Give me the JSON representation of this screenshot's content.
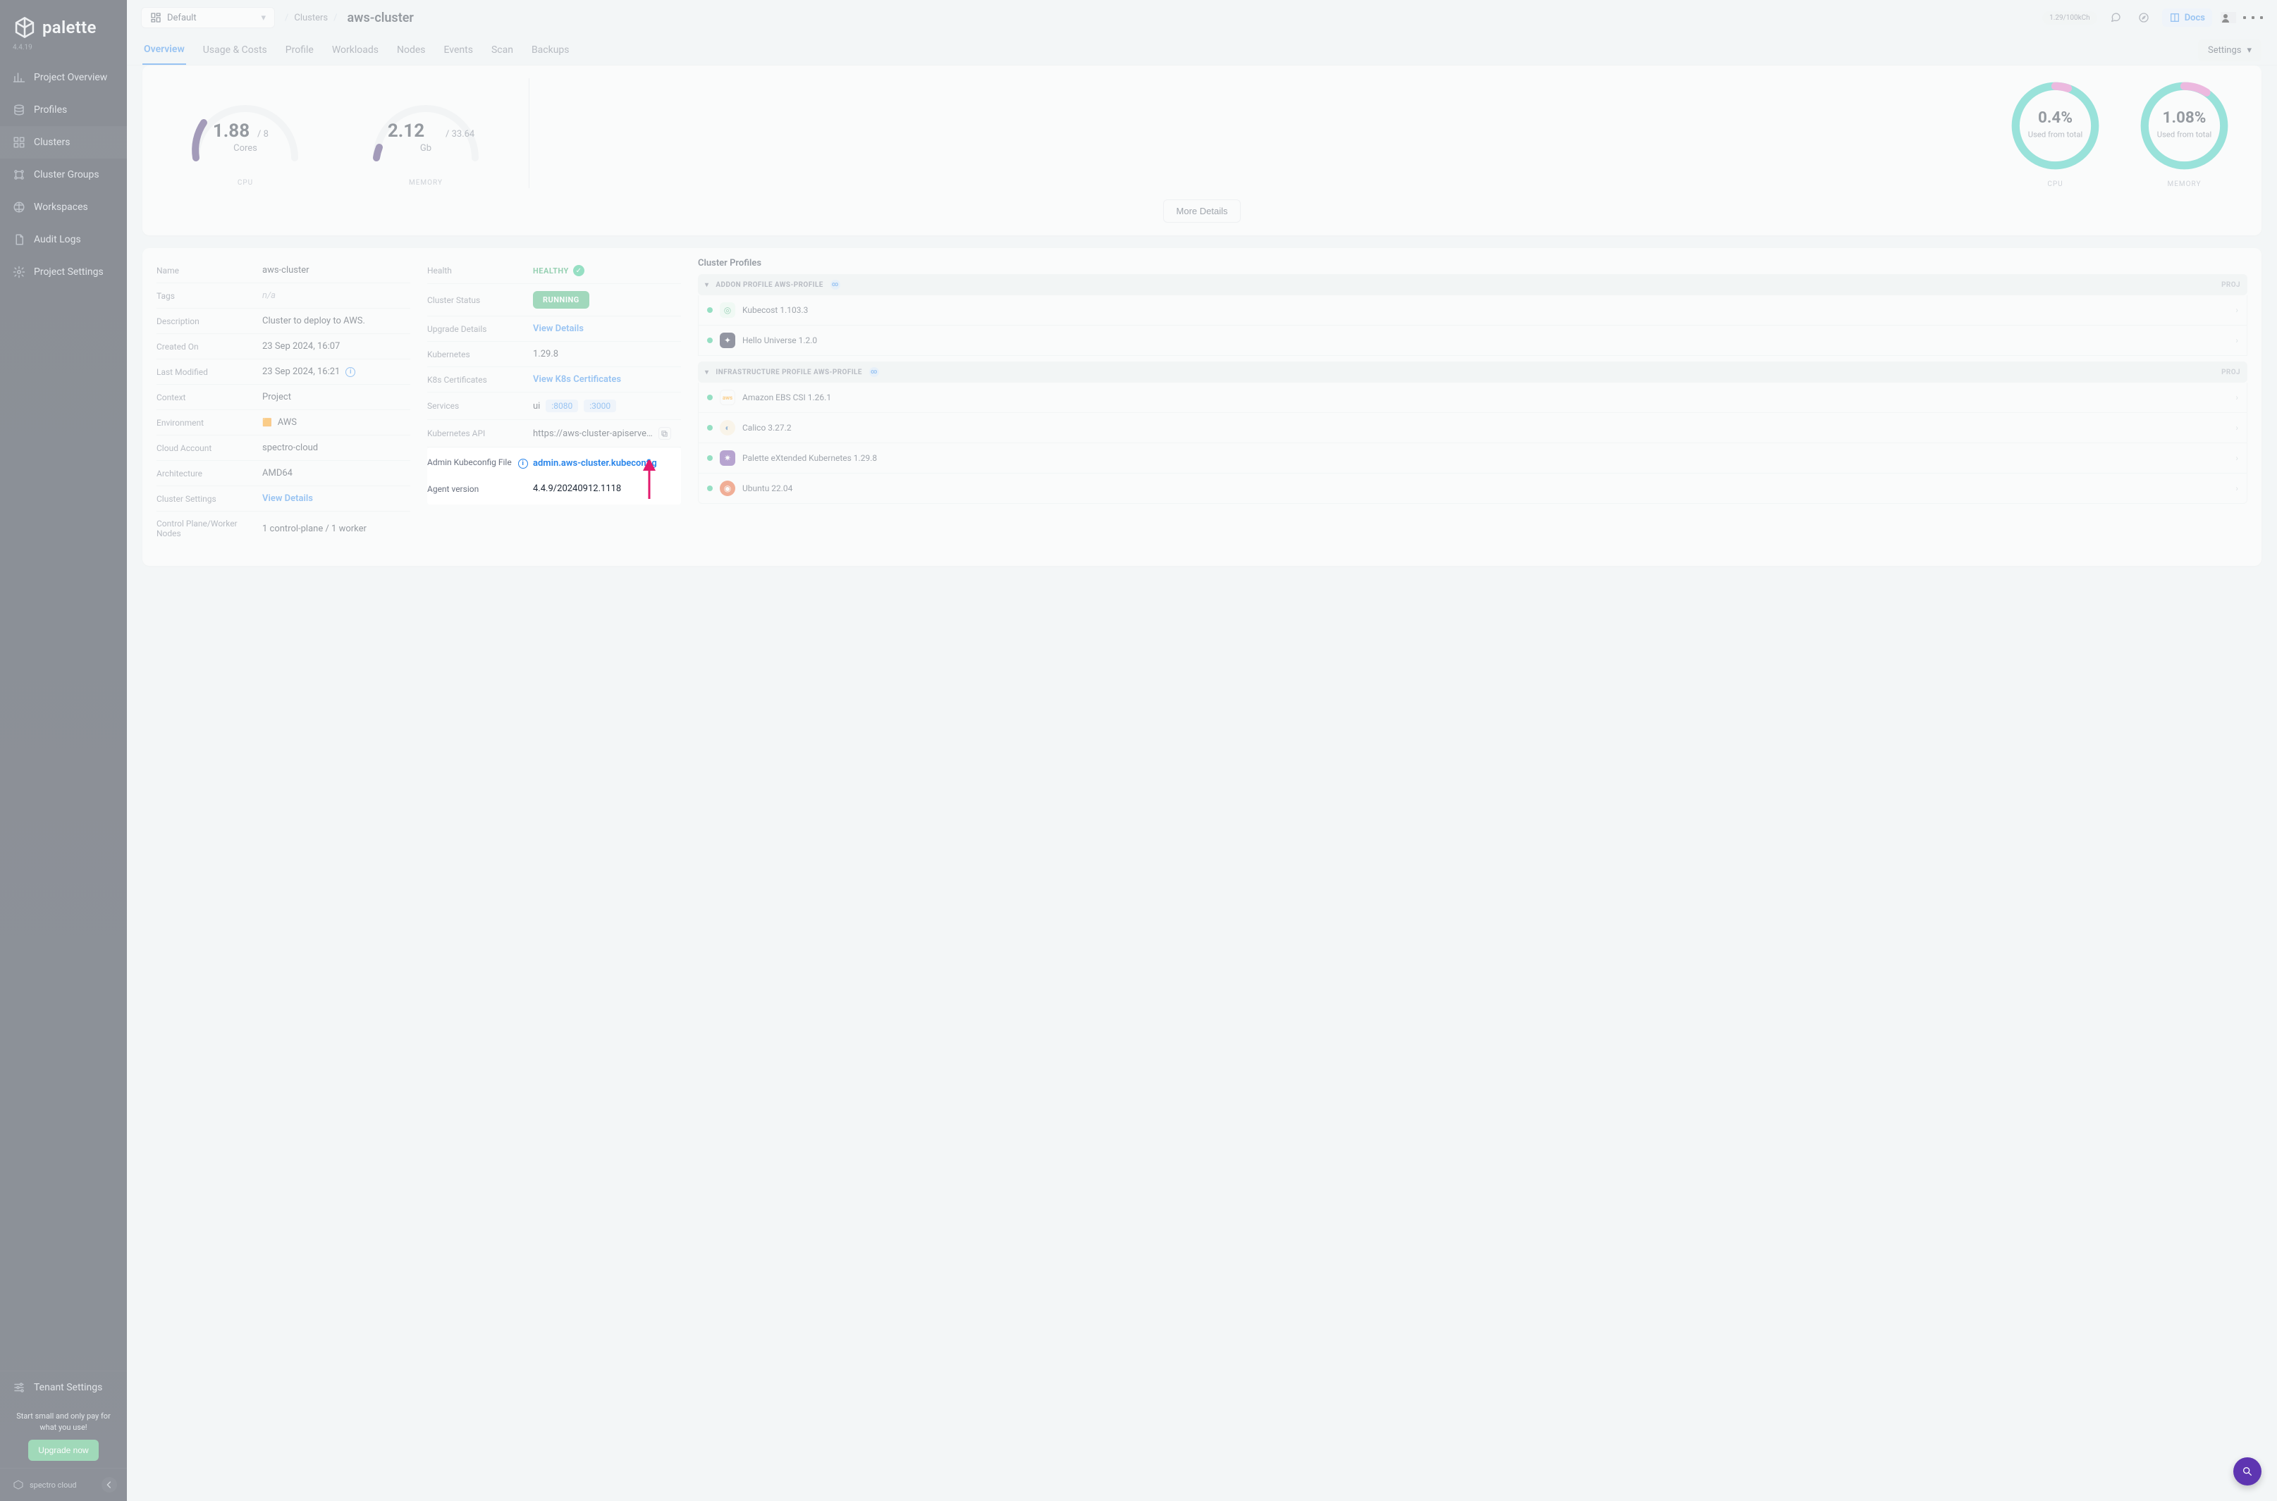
{
  "brand": {
    "name": "palette",
    "version": "4.4.19"
  },
  "sidebar": {
    "items": [
      {
        "label": "Project Overview"
      },
      {
        "label": "Profiles"
      },
      {
        "label": "Clusters"
      },
      {
        "label": "Cluster Groups"
      },
      {
        "label": "Workspaces"
      },
      {
        "label": "Audit Logs"
      },
      {
        "label": "Project Settings"
      }
    ],
    "active_index": 2,
    "tenant_label": "Tenant Settings",
    "upgrade_note": "Start small and only pay for what you use!",
    "upgrade_button": "Upgrade now",
    "footer_brand": "spectro cloud"
  },
  "topbar": {
    "scope_label": "Default",
    "breadcrumbs": {
      "clusters": "Clusters",
      "current": "aws-cluster"
    },
    "credit": "1.29/100kCh",
    "docs_label": "Docs"
  },
  "tabs": {
    "items": [
      "Overview",
      "Usage & Costs",
      "Profile",
      "Workloads",
      "Nodes",
      "Events",
      "Scan",
      "Backups"
    ],
    "active_index": 0,
    "settings_label": "Settings"
  },
  "metrics": {
    "cpu": {
      "value": "1.88",
      "total": " / 8",
      "label": "Cores",
      "caption": "CPU"
    },
    "memory": {
      "value": "2.12",
      "total": " / 33.64",
      "label": "Gb",
      "caption": "MEMORY"
    },
    "used_cpu": {
      "percent": "0.4%",
      "sub": "Used from total",
      "caption": "CPU"
    },
    "used_mem": {
      "percent": "1.08%",
      "sub": "Used from total",
      "caption": "MEMORY"
    },
    "more_label": "More Details"
  },
  "details": {
    "left": {
      "name": {
        "k": "Name",
        "v": "aws-cluster"
      },
      "tags": {
        "k": "Tags",
        "v": "n/a"
      },
      "description": {
        "k": "Description",
        "v": "Cluster to deploy to AWS."
      },
      "created": {
        "k": "Created On",
        "v": "23 Sep 2024, 16:07"
      },
      "modified": {
        "k": "Last Modified",
        "v": "23 Sep 2024, 16:21"
      },
      "context": {
        "k": "Context",
        "v": "Project"
      },
      "env": {
        "k": "Environment",
        "v": "AWS"
      },
      "account": {
        "k": "Cloud Account",
        "v": "spectro-cloud"
      },
      "arch": {
        "k": "Architecture",
        "v": "AMD64"
      },
      "csettings": {
        "k": "Cluster Settings",
        "v": "View Details"
      },
      "cpwn": {
        "k": "Control Plane/Worker Nodes",
        "v": "1 control-plane / 1 worker"
      }
    },
    "right": {
      "health": {
        "k": "Health",
        "v": "HEALTHY"
      },
      "status": {
        "k": "Cluster Status",
        "v": "RUNNING"
      },
      "upgrade": {
        "k": "Upgrade Details",
        "v": "View Details"
      },
      "k8s": {
        "k": "Kubernetes",
        "v": "1.29.8"
      },
      "certs": {
        "k": "K8s Certificates",
        "v": "View K8s Certificates"
      },
      "services": {
        "k": "Services",
        "prefix": "ui",
        "p1": ":8080",
        "p2": ":3000"
      },
      "api": {
        "k": "Kubernetes API",
        "v": "https://aws-cluster-apiserve…"
      },
      "kubeconfig": {
        "k": "Admin Kubeconfig File",
        "v": "admin.aws-cluster.kubeconfig"
      },
      "agent": {
        "k": "Agent version",
        "v": "4.4.9/20240912.1118"
      }
    }
  },
  "profiles": {
    "title": "Cluster Profiles",
    "addon": {
      "label": "ADDON PROFILE AWS-PROFILE",
      "badge": "PROJ",
      "packs": [
        {
          "name": "Kubecost 1.103.3",
          "color": "#2ea36b"
        },
        {
          "name": "Hello Universe 1.2.0",
          "color": "#1b1f3b"
        }
      ]
    },
    "infra": {
      "label": "INFRASTRUCTURE PROFILE AWS-PROFILE",
      "badge": "PROJ",
      "packs": [
        {
          "name": "Amazon EBS CSI 1.26.1",
          "color": "#f3f4f6"
        },
        {
          "name": "Calico 3.27.2",
          "color": "#2f6fb0"
        },
        {
          "name": "Palette eXtended Kubernetes 1.29.8",
          "color": "#6b3fa0"
        },
        {
          "name": "Ubuntu 22.04",
          "color": "#e95420"
        }
      ]
    }
  },
  "chart_data": [
    {
      "type": "gauge",
      "title": "CPU Cores",
      "value": 1.88,
      "max": 8,
      "unit": "Cores"
    },
    {
      "type": "gauge",
      "title": "Memory Gb",
      "value": 2.12,
      "max": 33.64,
      "unit": "Gb"
    },
    {
      "type": "donut",
      "title": "CPU Used from total",
      "value_pct": 0.4
    },
    {
      "type": "donut",
      "title": "Memory Used from total",
      "value_pct": 1.08
    }
  ]
}
